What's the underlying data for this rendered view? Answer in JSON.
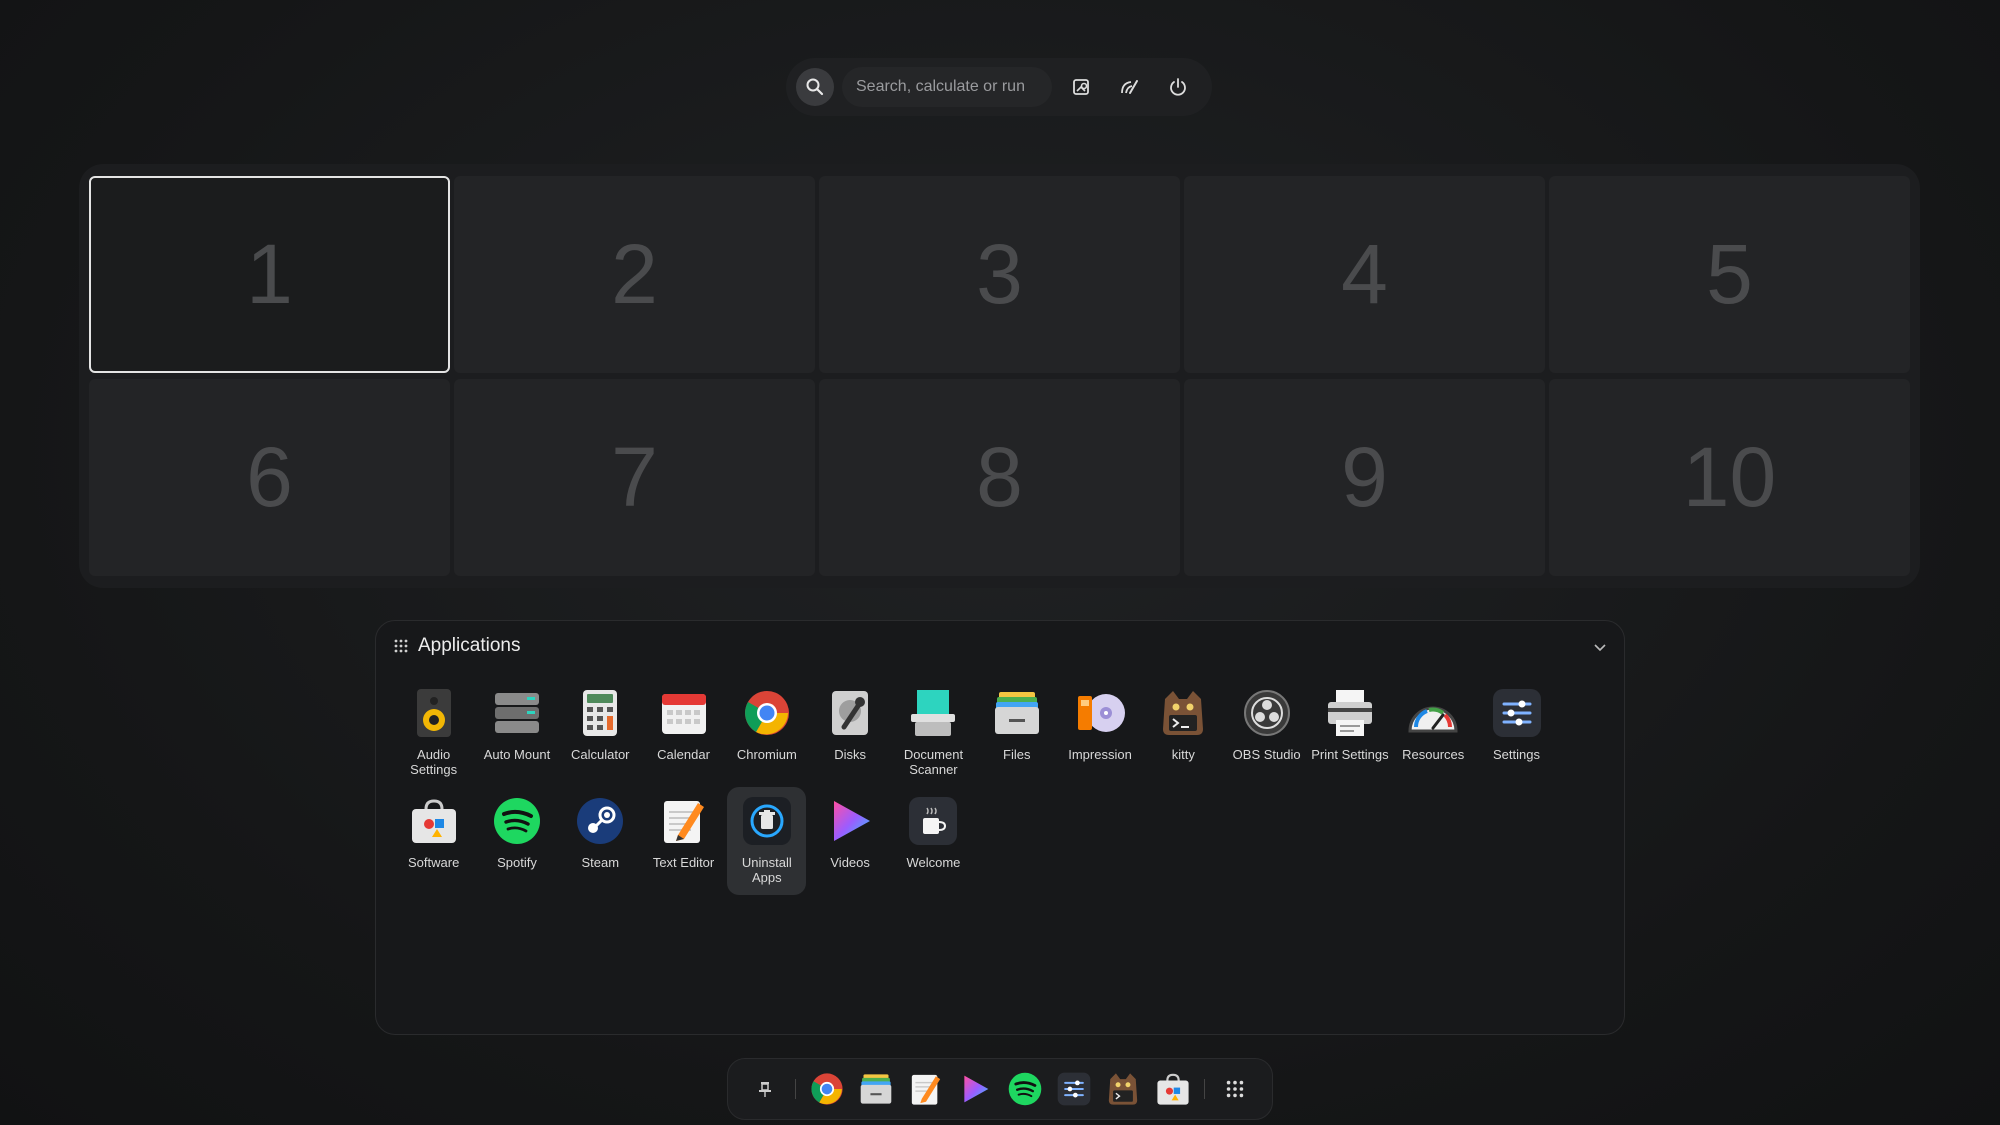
{
  "search": {
    "placeholder": "Search, calculate or run"
  },
  "workspaces": [
    "1",
    "2",
    "3",
    "4",
    "5",
    "6",
    "7",
    "8",
    "9",
    "10"
  ],
  "active_workspace": "1",
  "applications": {
    "title": "Applications",
    "apps": [
      {
        "label": "Audio Settings",
        "icon": "audio-settings-icon"
      },
      {
        "label": "Auto Mount",
        "icon": "auto-mount-icon"
      },
      {
        "label": "Calculator",
        "icon": "calculator-icon"
      },
      {
        "label": "Calendar",
        "icon": "calendar-icon"
      },
      {
        "label": "Chromium",
        "icon": "chromium-icon"
      },
      {
        "label": "Disks",
        "icon": "disks-icon"
      },
      {
        "label": "Document Scanner",
        "icon": "document-scanner-icon"
      },
      {
        "label": "Files",
        "icon": "files-icon"
      },
      {
        "label": "Impression",
        "icon": "impression-icon"
      },
      {
        "label": "kitty",
        "icon": "kitty-icon"
      },
      {
        "label": "OBS Studio",
        "icon": "obs-studio-icon"
      },
      {
        "label": "Print Settings",
        "icon": "print-settings-icon"
      },
      {
        "label": "Resources",
        "icon": "resources-icon"
      },
      {
        "label": "Settings",
        "icon": "settings-icon"
      },
      {
        "label": "Software",
        "icon": "software-icon"
      },
      {
        "label": "Spotify",
        "icon": "spotify-icon"
      },
      {
        "label": "Steam",
        "icon": "steam-icon"
      },
      {
        "label": "Text Editor",
        "icon": "text-editor-icon"
      },
      {
        "label": "Uninstall Apps",
        "icon": "uninstall-apps-icon"
      },
      {
        "label": "Videos",
        "icon": "videos-icon"
      },
      {
        "label": "Welcome",
        "icon": "welcome-icon"
      }
    ],
    "selected": "Uninstall Apps"
  },
  "dock": [
    "pin-icon",
    "chromium-icon",
    "files-icon",
    "text-editor-icon",
    "videos-icon",
    "spotify-icon",
    "settings-icon",
    "kitty-icon",
    "software-icon",
    "app-grid-icon"
  ],
  "colors": {
    "background": "#151617",
    "panel": "#17181a",
    "accent_active_border": "#e4e4e4",
    "spotify": "#1ed760"
  }
}
